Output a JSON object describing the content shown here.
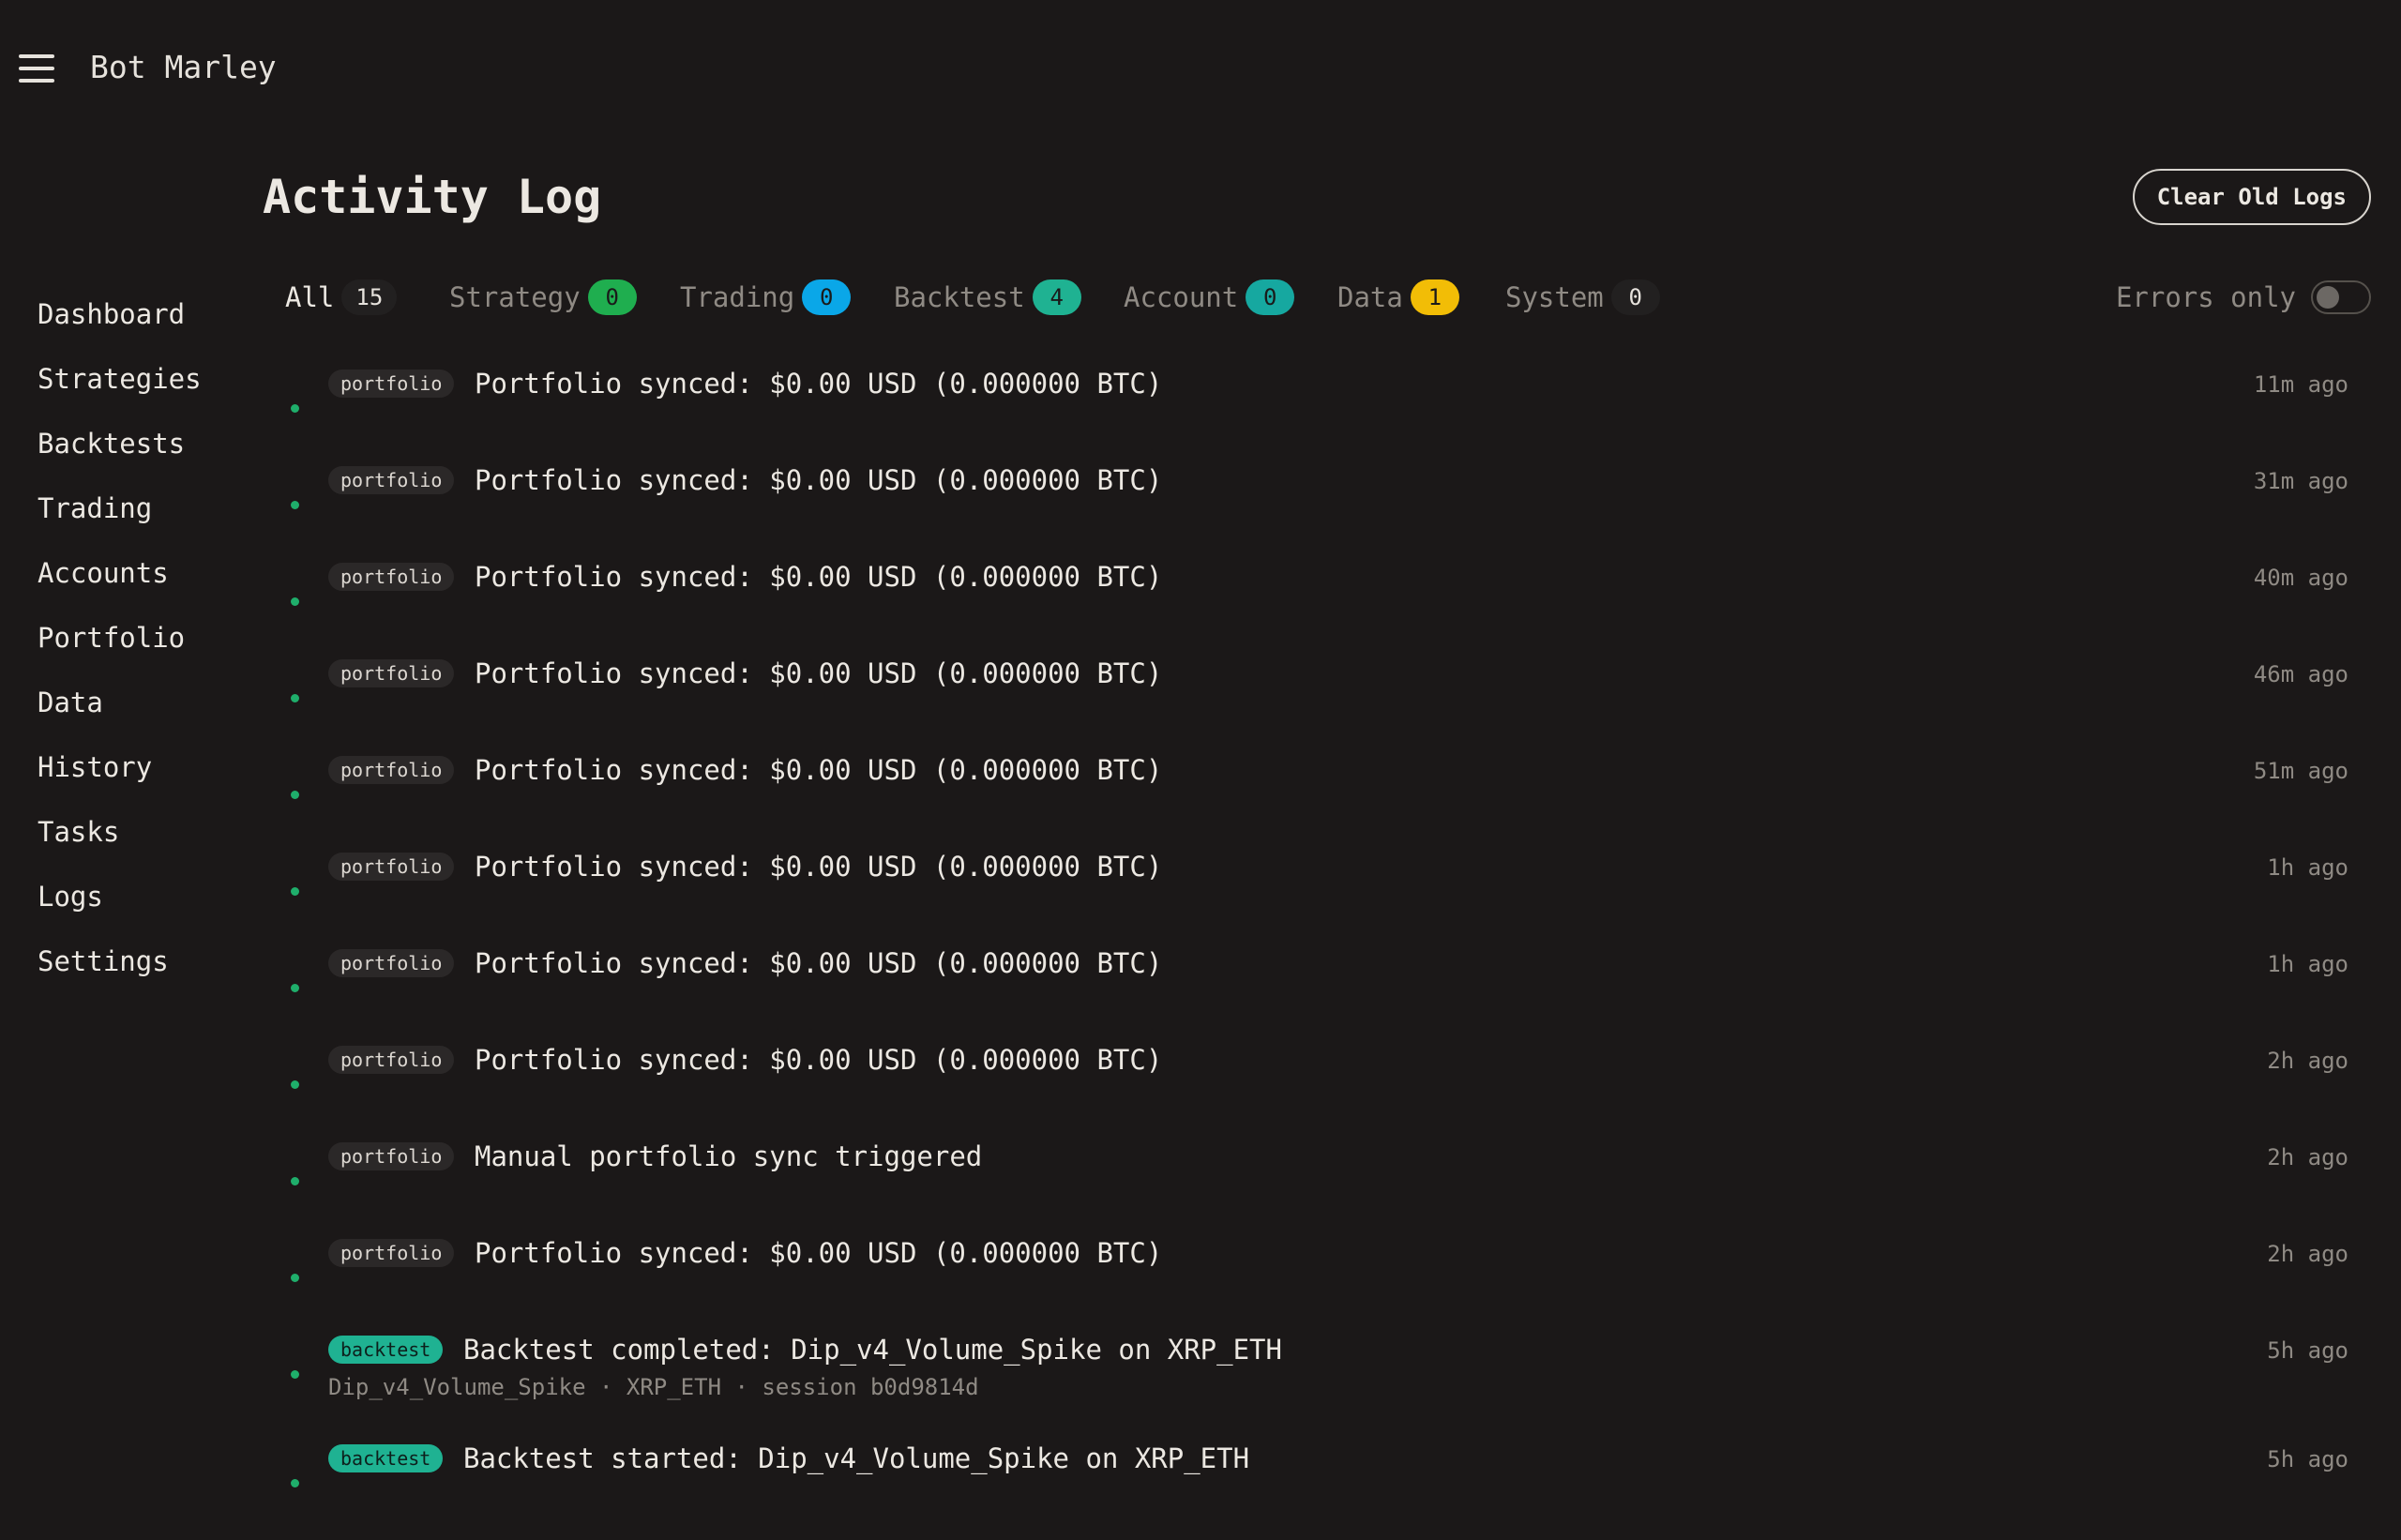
{
  "app": {
    "title": "Bot Marley",
    "menu_icon": "hamburger-icon"
  },
  "nav": {
    "items": [
      {
        "label": "Dashboard"
      },
      {
        "label": "Strategies"
      },
      {
        "label": "Backtests"
      },
      {
        "label": "Trading"
      },
      {
        "label": "Accounts"
      },
      {
        "label": "Portfolio"
      },
      {
        "label": "Data"
      },
      {
        "label": "History"
      },
      {
        "label": "Tasks"
      },
      {
        "label": "Logs"
      },
      {
        "label": "Settings"
      }
    ]
  },
  "page": {
    "title": "Activity Log",
    "clear_button": "Clear Old Logs"
  },
  "filters": {
    "active": "All",
    "tabs": [
      {
        "label": "All",
        "count": "15",
        "color": "#222020",
        "count_text_color": "#e6e2dc"
      },
      {
        "label": "Strategy",
        "count": "0",
        "color": "#1fae4f",
        "count_text_color": "#1a1a1a"
      },
      {
        "label": "Trading",
        "count": "0",
        "color": "#0aa7e8",
        "count_text_color": "#1a1a1a"
      },
      {
        "label": "Backtest",
        "count": "4",
        "color": "#1fb292",
        "count_text_color": "#1a1a1a"
      },
      {
        "label": "Account",
        "count": "0",
        "color": "#16a8a0",
        "count_text_color": "#1a1a1a"
      },
      {
        "label": "Data",
        "count": "1",
        "color": "#f2bd06",
        "count_text_color": "#1a1a1a"
      },
      {
        "label": "System",
        "count": "0",
        "color": "#222020",
        "count_text_color": "#e6e2dc"
      }
    ],
    "errors_only": {
      "label": "Errors only",
      "enabled": false
    }
  },
  "logs": [
    {
      "tag": "portfolio",
      "message": "Portfolio synced: $0.00 USD (0.000000 BTC)",
      "time": "11m ago",
      "status_color": "#1fae6b"
    },
    {
      "tag": "portfolio",
      "message": "Portfolio synced: $0.00 USD (0.000000 BTC)",
      "time": "31m ago",
      "status_color": "#1fae6b"
    },
    {
      "tag": "portfolio",
      "message": "Portfolio synced: $0.00 USD (0.000000 BTC)",
      "time": "40m ago",
      "status_color": "#1fae6b"
    },
    {
      "tag": "portfolio",
      "message": "Portfolio synced: $0.00 USD (0.000000 BTC)",
      "time": "46m ago",
      "status_color": "#1fae6b"
    },
    {
      "tag": "portfolio",
      "message": "Portfolio synced: $0.00 USD (0.000000 BTC)",
      "time": "51m ago",
      "status_color": "#1fae6b"
    },
    {
      "tag": "portfolio",
      "message": "Portfolio synced: $0.00 USD (0.000000 BTC)",
      "time": "1h ago",
      "status_color": "#1fae6b"
    },
    {
      "tag": "portfolio",
      "message": "Portfolio synced: $0.00 USD (0.000000 BTC)",
      "time": "1h ago",
      "status_color": "#1fae6b"
    },
    {
      "tag": "portfolio",
      "message": "Portfolio synced: $0.00 USD (0.000000 BTC)",
      "time": "2h ago",
      "status_color": "#1fae6b"
    },
    {
      "tag": "portfolio",
      "message": "Manual portfolio sync triggered",
      "time": "2h ago",
      "status_color": "#1fae6b"
    },
    {
      "tag": "portfolio",
      "message": "Portfolio synced: $0.00 USD (0.000000 BTC)",
      "time": "2h ago",
      "status_color": "#1fae6b"
    },
    {
      "tag": "backtest",
      "message": "Backtest completed: Dip_v4_Volume_Spike on XRP_ETH",
      "detail": "Dip_v4_Volume_Spike · XRP_ETH · session b0d9814d",
      "time": "5h ago",
      "status_color": "#1fae6b"
    },
    {
      "tag": "backtest",
      "message": "Backtest started: Dip_v4_Volume_Spike on XRP_ETH",
      "time": "5h ago",
      "status_color": "#1fae6b"
    }
  ]
}
